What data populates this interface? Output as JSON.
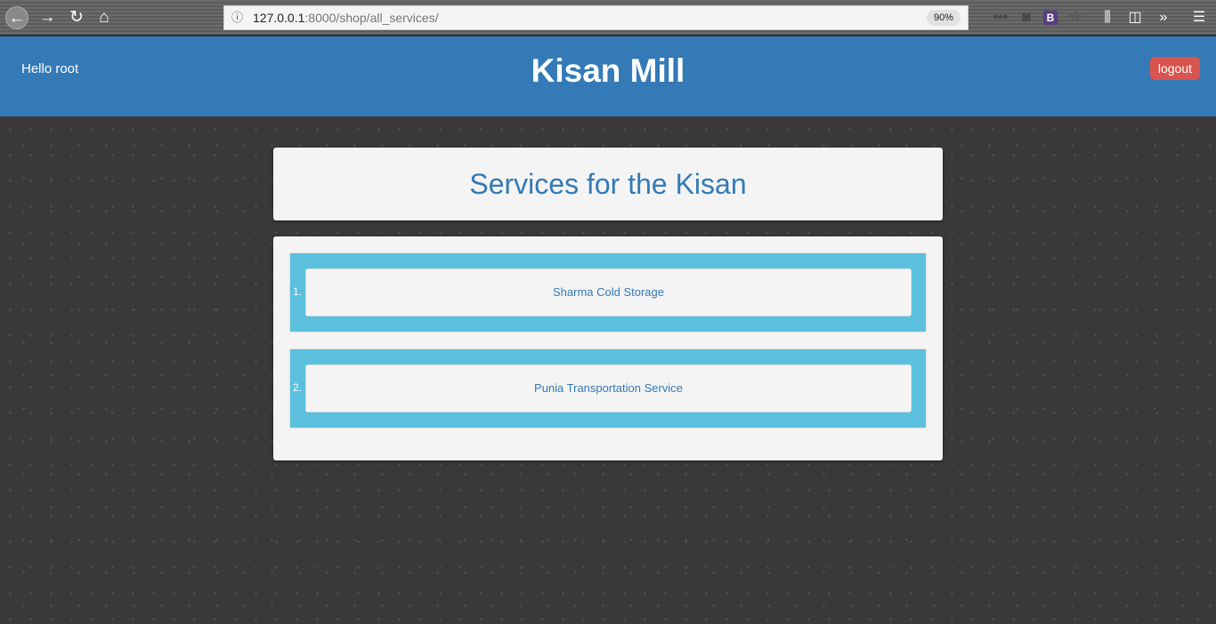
{
  "browser": {
    "url_host": "127.0.0.1",
    "url_rest": ":8000/shop/all_services/",
    "zoom": "90%"
  },
  "header": {
    "greeting": "Hello root",
    "brand": "Kisan Mill",
    "logout": "logout"
  },
  "page": {
    "title": "Services for the Kisan"
  },
  "services": [
    {
      "num": "1.",
      "name": "Sharma Cold Storage"
    },
    {
      "num": "2.",
      "name": "Punia Transportation Service"
    }
  ]
}
